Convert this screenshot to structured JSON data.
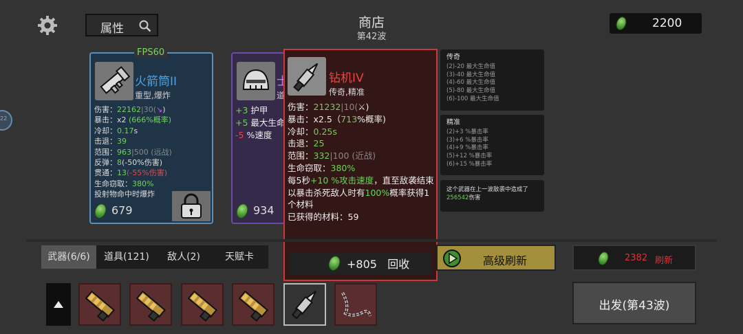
{
  "header": {
    "title": "商店",
    "wave": "第42波",
    "filter_label": "属性",
    "money": "2200",
    "fps": "FPS60"
  },
  "card_rocket": {
    "name": "火箭筒II",
    "tags": "重型,爆炸",
    "stats": [
      {
        "label": "伤害：",
        "main": "22162",
        "extra": "|30(",
        "icon": "crit-icon",
        "tail": ")"
      },
      {
        "label": "暴击：",
        "main": "x2",
        "extra": "(666%概率)"
      },
      {
        "label": "冷却：",
        "main": "0.17",
        "extra": "s"
      },
      {
        "label": "击退：",
        "main": "39"
      },
      {
        "label": "范围：",
        "main": "963",
        "extra": "|500 (远战)"
      },
      {
        "label": "反弹：",
        "main": "8",
        "extra": "(-50%伤害)"
      },
      {
        "label": "贯通：",
        "main": "13",
        "extra": "(-55%伤害)"
      },
      {
        "label": "生命窃取：",
        "main": "380%"
      },
      {
        "label": "投射物命中时爆炸"
      }
    ],
    "price": "679"
  },
  "card_helmet": {
    "name_partial": "士",
    "tag_partial": "道",
    "stats": [
      {
        "value": "+3",
        "label": "护甲"
      },
      {
        "value": "+5",
        "label": "最大生命"
      },
      {
        "value": "-5",
        "label": "%速度"
      }
    ],
    "price": "934"
  },
  "tooltip": {
    "name": "钻机IV",
    "tags": "传奇,精准",
    "stats": {
      "damage_label": "伤害：",
      "damage_main": "21232",
      "damage_extra": "|10(",
      "damage_tail": ")",
      "crit_label": "暴击：",
      "crit_main": "x2.5（",
      "crit_pct": "713",
      "crit_tail": "%概率)",
      "cooldown_label": "冷却：",
      "cooldown": "0.25s",
      "knockback_label": "击退：",
      "knockback": "25",
      "range_label": "范围：",
      "range_main": "332",
      "range_extra": "|100 (近战)",
      "lifesteal_label": "生命窃取：",
      "lifesteal": "380%",
      "effect1_pre": "每5秒",
      "effect1_value": "+10 %攻击速度",
      "effect1_post": "，直至敌袭结束",
      "effect2_pre": "以暴击杀死敌人时有",
      "effect2_value": "100%",
      "effect2_post": "概率获得1个材料",
      "materials_label": "已获得的材料：",
      "materials": "59"
    },
    "recycle_value": "+805",
    "recycle_label": "回收"
  },
  "panel_legendary": {
    "title": "传奇",
    "lines": [
      "(2)-20 最大生命值",
      "(3)-40 最大生命值",
      "(4)-60 最大生命值",
      "(5)-80 最大生命值",
      "(6)-100 最大生命值"
    ]
  },
  "panel_precise": {
    "title": "精准",
    "lines": [
      "(2)+3 %暴击率",
      "(3)+6 %暴击率",
      "(4)+9 %暴击率",
      "(5)+12 %暴击率",
      "(6)+15 %暴击率"
    ]
  },
  "panel_damage": {
    "text_pre": "这个武器在上一波敌袭中造成了",
    "value": "256542",
    "text_post": "伤害"
  },
  "tabs": [
    "武器(6/6)",
    "道具(121)",
    "敌人(2)",
    "天赋卡"
  ],
  "buttons": {
    "refresh_big": "高级刷新",
    "refresh_cost": "2382",
    "refresh_label": "刷新",
    "go": "出发(第43波)"
  },
  "inventory": [
    "rocket-launcher",
    "rocket-launcher",
    "rocket-launcher",
    "rocket-launcher",
    "drill",
    "chain-whip"
  ],
  "side_badge": "22",
  "colors": {
    "legendary": "#e44444",
    "rare": "#4aa3e0",
    "positive": "#6fd35b",
    "negative": "#e14a4a"
  }
}
